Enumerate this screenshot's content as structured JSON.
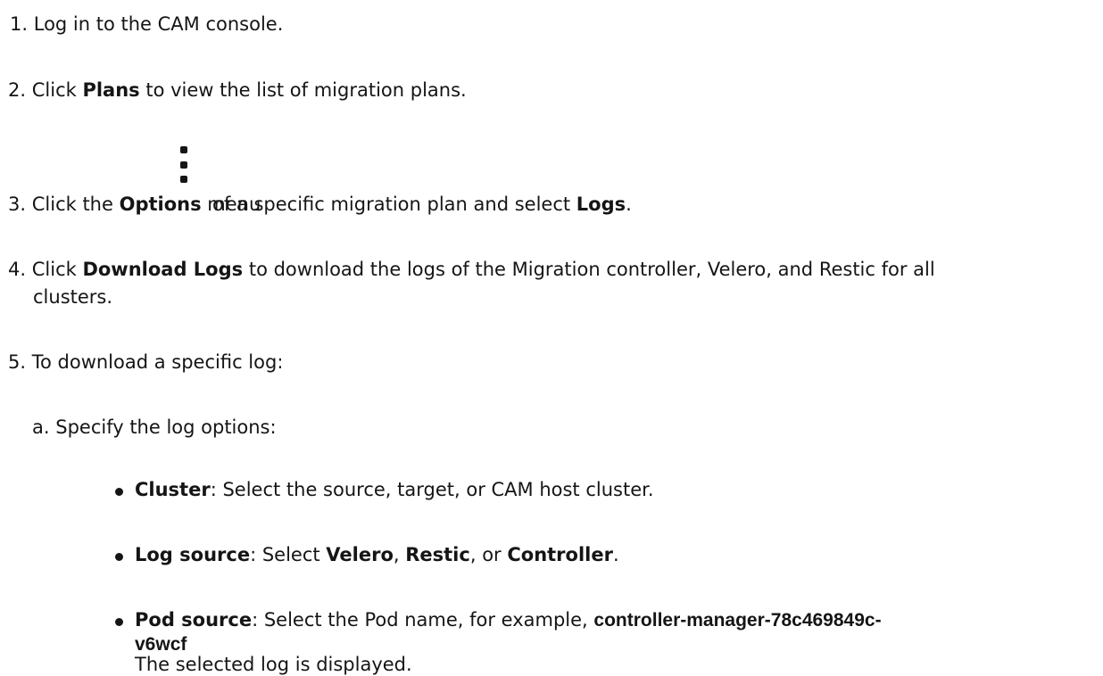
{
  "steps": [
    {
      "number": "1.",
      "text": "Log in to the CAM console."
    },
    {
      "number": "2.",
      "pre": "Click ",
      "bold": "Plans",
      "post": " to view the list of migration plans."
    },
    {
      "number": "3.",
      "pre": "Click the ",
      "bold": "Options",
      "mid": " menu",
      "post": "of a specific migration plan and select ",
      "bold2": "Logs",
      "end": "."
    },
    {
      "number": "4.",
      "pre": "Click ",
      "bold": "Download Logs",
      "post": " to download the logs of the Migration controller, Velero, and Restic for all",
      "line2": "clusters."
    },
    {
      "number": "5.",
      "text": "To download a specific log:"
    }
  ],
  "substep": {
    "letter": "a.",
    "text": "Specify the log options:"
  },
  "options": [
    {
      "label": "Cluster",
      "text": ": Select the source, target, or CAM host cluster."
    },
    {
      "label": "Log source",
      "pre": ": Select ",
      "v1": "Velero",
      "sep1": ", ",
      "v2": "Restic",
      "sep2": ", or ",
      "v3": "Controller",
      "end": "."
    },
    {
      "label": "Pod source",
      "pre": ": Select the Pod name, for example, ",
      "code1": "controller-manager-78c469849c-",
      "code2": "v6wcf",
      "result": "The selected log is displayed."
    }
  ],
  "icons": {
    "options_menu": "kebab-icon"
  }
}
